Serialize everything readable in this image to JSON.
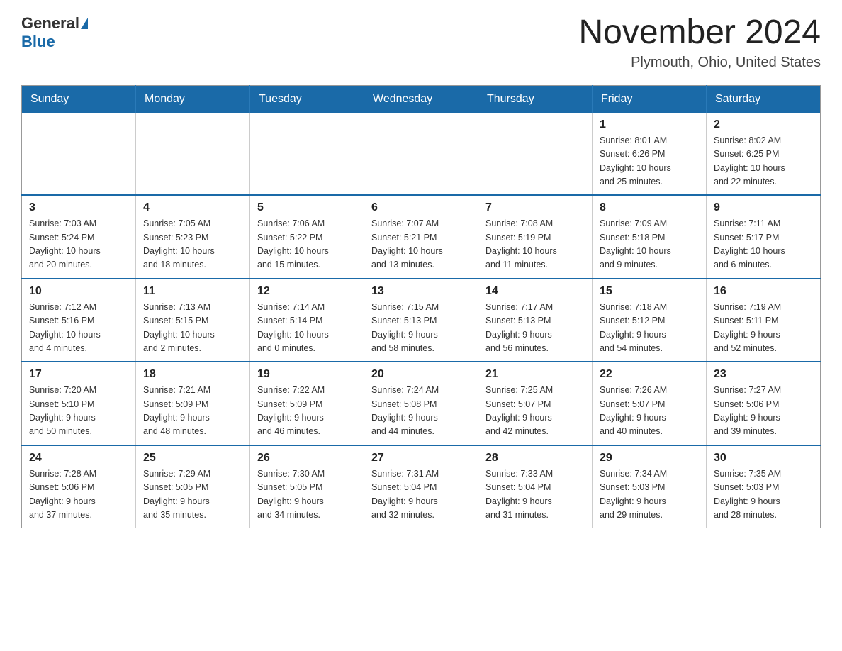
{
  "logo": {
    "general": "General",
    "blue": "Blue"
  },
  "title": "November 2024",
  "location": "Plymouth, Ohio, United States",
  "weekdays": [
    "Sunday",
    "Monday",
    "Tuesday",
    "Wednesday",
    "Thursday",
    "Friday",
    "Saturday"
  ],
  "weeks": [
    [
      {
        "day": "",
        "info": ""
      },
      {
        "day": "",
        "info": ""
      },
      {
        "day": "",
        "info": ""
      },
      {
        "day": "",
        "info": ""
      },
      {
        "day": "",
        "info": ""
      },
      {
        "day": "1",
        "info": "Sunrise: 8:01 AM\nSunset: 6:26 PM\nDaylight: 10 hours\nand 25 minutes."
      },
      {
        "day": "2",
        "info": "Sunrise: 8:02 AM\nSunset: 6:25 PM\nDaylight: 10 hours\nand 22 minutes."
      }
    ],
    [
      {
        "day": "3",
        "info": "Sunrise: 7:03 AM\nSunset: 5:24 PM\nDaylight: 10 hours\nand 20 minutes."
      },
      {
        "day": "4",
        "info": "Sunrise: 7:05 AM\nSunset: 5:23 PM\nDaylight: 10 hours\nand 18 minutes."
      },
      {
        "day": "5",
        "info": "Sunrise: 7:06 AM\nSunset: 5:22 PM\nDaylight: 10 hours\nand 15 minutes."
      },
      {
        "day": "6",
        "info": "Sunrise: 7:07 AM\nSunset: 5:21 PM\nDaylight: 10 hours\nand 13 minutes."
      },
      {
        "day": "7",
        "info": "Sunrise: 7:08 AM\nSunset: 5:19 PM\nDaylight: 10 hours\nand 11 minutes."
      },
      {
        "day": "8",
        "info": "Sunrise: 7:09 AM\nSunset: 5:18 PM\nDaylight: 10 hours\nand 9 minutes."
      },
      {
        "day": "9",
        "info": "Sunrise: 7:11 AM\nSunset: 5:17 PM\nDaylight: 10 hours\nand 6 minutes."
      }
    ],
    [
      {
        "day": "10",
        "info": "Sunrise: 7:12 AM\nSunset: 5:16 PM\nDaylight: 10 hours\nand 4 minutes."
      },
      {
        "day": "11",
        "info": "Sunrise: 7:13 AM\nSunset: 5:15 PM\nDaylight: 10 hours\nand 2 minutes."
      },
      {
        "day": "12",
        "info": "Sunrise: 7:14 AM\nSunset: 5:14 PM\nDaylight: 10 hours\nand 0 minutes."
      },
      {
        "day": "13",
        "info": "Sunrise: 7:15 AM\nSunset: 5:13 PM\nDaylight: 9 hours\nand 58 minutes."
      },
      {
        "day": "14",
        "info": "Sunrise: 7:17 AM\nSunset: 5:13 PM\nDaylight: 9 hours\nand 56 minutes."
      },
      {
        "day": "15",
        "info": "Sunrise: 7:18 AM\nSunset: 5:12 PM\nDaylight: 9 hours\nand 54 minutes."
      },
      {
        "day": "16",
        "info": "Sunrise: 7:19 AM\nSunset: 5:11 PM\nDaylight: 9 hours\nand 52 minutes."
      }
    ],
    [
      {
        "day": "17",
        "info": "Sunrise: 7:20 AM\nSunset: 5:10 PM\nDaylight: 9 hours\nand 50 minutes."
      },
      {
        "day": "18",
        "info": "Sunrise: 7:21 AM\nSunset: 5:09 PM\nDaylight: 9 hours\nand 48 minutes."
      },
      {
        "day": "19",
        "info": "Sunrise: 7:22 AM\nSunset: 5:09 PM\nDaylight: 9 hours\nand 46 minutes."
      },
      {
        "day": "20",
        "info": "Sunrise: 7:24 AM\nSunset: 5:08 PM\nDaylight: 9 hours\nand 44 minutes."
      },
      {
        "day": "21",
        "info": "Sunrise: 7:25 AM\nSunset: 5:07 PM\nDaylight: 9 hours\nand 42 minutes."
      },
      {
        "day": "22",
        "info": "Sunrise: 7:26 AM\nSunset: 5:07 PM\nDaylight: 9 hours\nand 40 minutes."
      },
      {
        "day": "23",
        "info": "Sunrise: 7:27 AM\nSunset: 5:06 PM\nDaylight: 9 hours\nand 39 minutes."
      }
    ],
    [
      {
        "day": "24",
        "info": "Sunrise: 7:28 AM\nSunset: 5:06 PM\nDaylight: 9 hours\nand 37 minutes."
      },
      {
        "day": "25",
        "info": "Sunrise: 7:29 AM\nSunset: 5:05 PM\nDaylight: 9 hours\nand 35 minutes."
      },
      {
        "day": "26",
        "info": "Sunrise: 7:30 AM\nSunset: 5:05 PM\nDaylight: 9 hours\nand 34 minutes."
      },
      {
        "day": "27",
        "info": "Sunrise: 7:31 AM\nSunset: 5:04 PM\nDaylight: 9 hours\nand 32 minutes."
      },
      {
        "day": "28",
        "info": "Sunrise: 7:33 AM\nSunset: 5:04 PM\nDaylight: 9 hours\nand 31 minutes."
      },
      {
        "day": "29",
        "info": "Sunrise: 7:34 AM\nSunset: 5:03 PM\nDaylight: 9 hours\nand 29 minutes."
      },
      {
        "day": "30",
        "info": "Sunrise: 7:35 AM\nSunset: 5:03 PM\nDaylight: 9 hours\nand 28 minutes."
      }
    ]
  ]
}
